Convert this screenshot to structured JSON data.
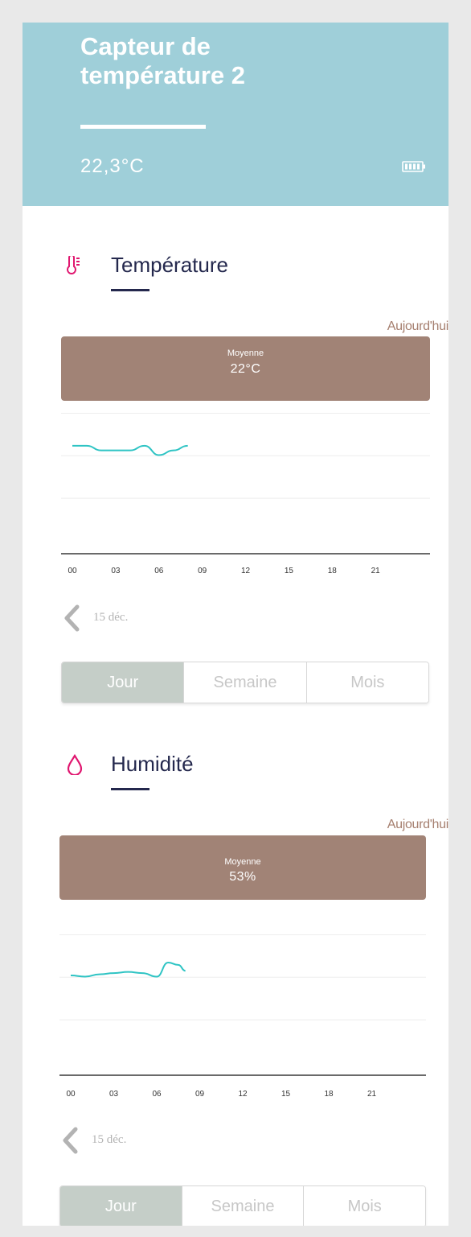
{
  "header": {
    "title_line1": "Capteur de",
    "title_line2": "température 2",
    "current_temp": "22,3°C",
    "battery_icon": "battery-icon"
  },
  "colors": {
    "header_bg": "#9fcfd9",
    "average_box": "#a18376",
    "series_line": "#2fc4c4",
    "section_title": "#24284d",
    "accent_pink": "#e0166f",
    "segment_active": "#c5cec8"
  },
  "temperature": {
    "icon": "thermometer-icon",
    "title": "Température",
    "period": "Aujourd'hui",
    "average_label": "Moyenne",
    "average_value": "22°C",
    "date": "15 déc.",
    "segments": [
      "Jour",
      "Semaine",
      "Mois"
    ],
    "active_segment": "Jour",
    "chart_data": {
      "type": "line",
      "x_ticks": [
        "00",
        "03",
        "06",
        "09",
        "12",
        "15",
        "18",
        "21"
      ],
      "x": [
        0,
        1,
        2,
        3,
        4,
        5,
        6,
        7,
        8
      ],
      "values": [
        22.3,
        22.3,
        22.2,
        22.2,
        22.2,
        22.3,
        22.1,
        22.2,
        22.3
      ],
      "xlim": [
        0,
        24
      ],
      "ylim": [
        20,
        23
      ],
      "grid": true
    }
  },
  "humidity": {
    "icon": "water-drop-icon",
    "title": "Humidité",
    "period": "Aujourd'hui",
    "average_label": "Moyenne",
    "average_value": "53%",
    "date": "15 déc.",
    "segments": [
      "Jour",
      "Semaine",
      "Mois"
    ],
    "active_segment": "Jour",
    "chart_data": {
      "type": "line",
      "x_ticks": [
        "00",
        "03",
        "06",
        "09",
        "12",
        "15",
        "18",
        "21"
      ],
      "x": [
        0,
        1,
        2,
        3,
        4,
        5,
        6,
        6.8,
        7.5,
        8
      ],
      "values": [
        52.5,
        52.4,
        52.6,
        52.7,
        52.8,
        52.7,
        52.4,
        53.6,
        53.4,
        52.9
      ],
      "xlim": [
        0,
        24
      ],
      "ylim": [
        44,
        56
      ],
      "grid": true
    }
  }
}
